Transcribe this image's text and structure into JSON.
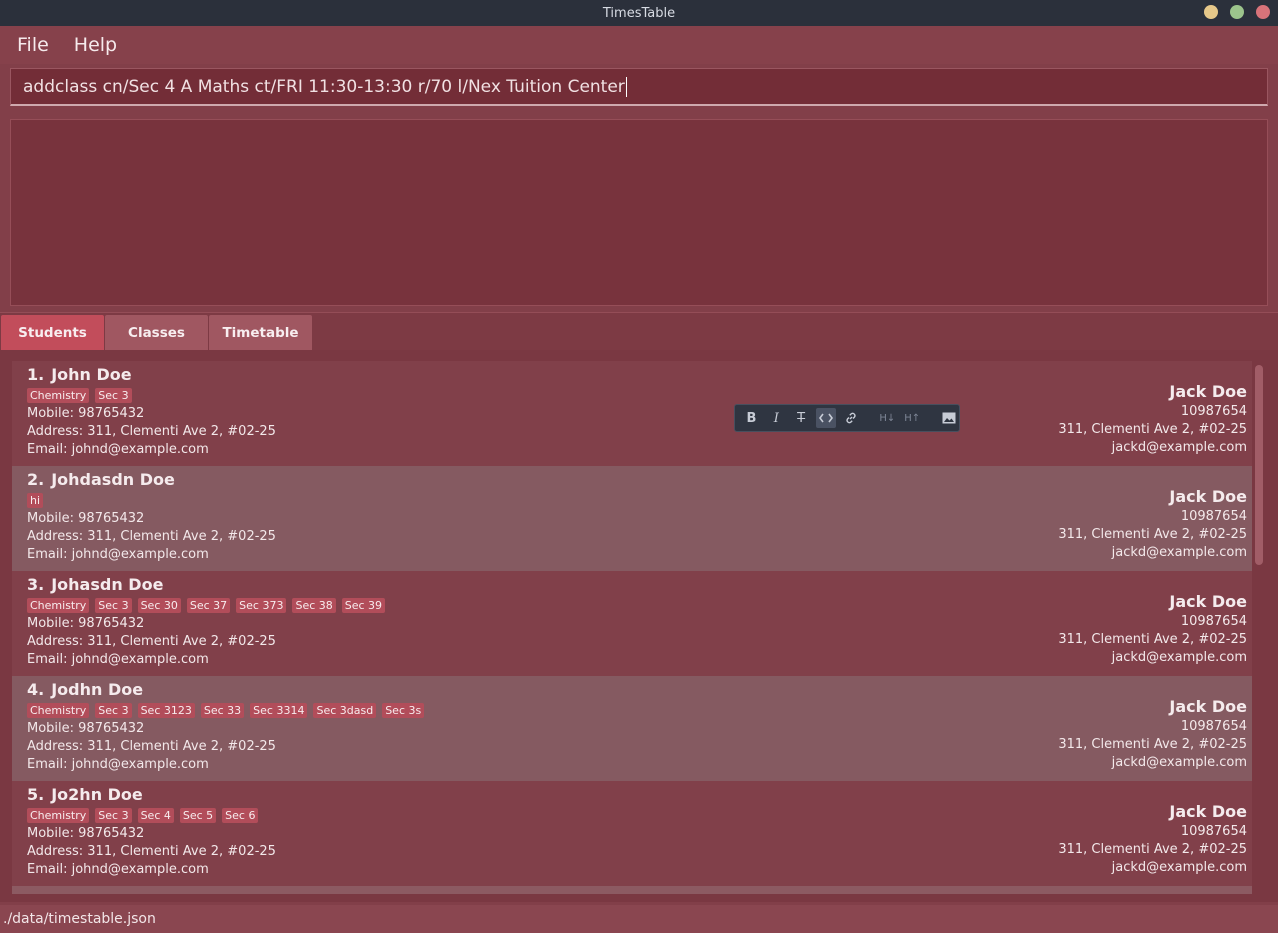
{
  "window": {
    "title": "TimesTable",
    "controls": [
      "minimize",
      "maximize",
      "close"
    ],
    "control_colors": [
      "#e6c88a",
      "#9cc48c",
      "#d8737a"
    ]
  },
  "menu": {
    "file": "File",
    "help": "Help"
  },
  "command": {
    "value": "addclass cn/Sec 4 A Maths ct/FRI 11:30-13:30 r/70 l/Nex Tuition Center"
  },
  "result": {
    "text": ""
  },
  "tabs": [
    {
      "label": "Students",
      "active": true
    },
    {
      "label": "Classes",
      "active": false
    },
    {
      "label": "Timetable",
      "active": false
    }
  ],
  "students": [
    {
      "index": "1.",
      "name": "John Doe",
      "tags": [
        "Chemistry",
        "Sec 3"
      ],
      "mobile": "Mobile: 98765432",
      "address": "Address: 311, Clementi Ave 2, #02-25",
      "email": "Email: johnd@example.com",
      "parent": {
        "name": "Jack Doe",
        "phone": "10987654",
        "address": "311, Clementi Ave 2, #02-25",
        "email": "jackd@example.com"
      }
    },
    {
      "index": "2.",
      "name": "Johdasdn Doe",
      "tags": [
        "hi"
      ],
      "mobile": "Mobile: 98765432",
      "address": "Address: 311, Clementi Ave 2, #02-25",
      "email": "Email: johnd@example.com",
      "parent": {
        "name": "Jack Doe",
        "phone": "10987654",
        "address": "311, Clementi Ave 2, #02-25",
        "email": "jackd@example.com"
      }
    },
    {
      "index": "3.",
      "name": "Johasdn Doe",
      "tags": [
        "Chemistry",
        "Sec 3",
        "Sec 30",
        "Sec 37",
        "Sec 373",
        "Sec 38",
        "Sec 39"
      ],
      "mobile": "Mobile: 98765432",
      "address": "Address: 311, Clementi Ave 2, #02-25",
      "email": "Email: johnd@example.com",
      "parent": {
        "name": "Jack Doe",
        "phone": "10987654",
        "address": "311, Clementi Ave 2, #02-25",
        "email": "jackd@example.com"
      }
    },
    {
      "index": "4.",
      "name": "Jodhn Doe",
      "tags": [
        "Chemistry",
        "Sec 3",
        "Sec 3123",
        "Sec 33",
        "Sec 3314",
        "Sec 3dasd",
        "Sec 3s"
      ],
      "mobile": "Mobile: 98765432",
      "address": "Address: 311, Clementi Ave 2, #02-25",
      "email": "Email: johnd@example.com",
      "parent": {
        "name": "Jack Doe",
        "phone": "10987654",
        "address": "311, Clementi Ave 2, #02-25",
        "email": "jackd@example.com"
      }
    },
    {
      "index": "5.",
      "name": "Jo2hn Doe",
      "tags": [
        "Chemistry",
        "Sec 3",
        "Sec 4",
        "Sec 5",
        "Sec 6"
      ],
      "mobile": "Mobile: 98765432",
      "address": "Address: 311, Clementi Ave 2, #02-25",
      "email": "Email: johnd@example.com",
      "parent": {
        "name": "Jack Doe",
        "phone": "10987654",
        "address": "311, Clementi Ave 2, #02-25",
        "email": "jackd@example.com"
      }
    }
  ],
  "format_toolbar": {
    "buttons": [
      "bold-icon",
      "italic-icon",
      "strikethrough-icon",
      "code-icon",
      "link-icon",
      "heading-decrease-icon",
      "heading-increase-icon",
      "image-icon"
    ],
    "glyphs": {
      "bold": "B",
      "italic": "I",
      "strike": "T",
      "h_down": "H↓",
      "h_up": "H↑"
    }
  },
  "status": {
    "path": "./data/timestable.json"
  }
}
